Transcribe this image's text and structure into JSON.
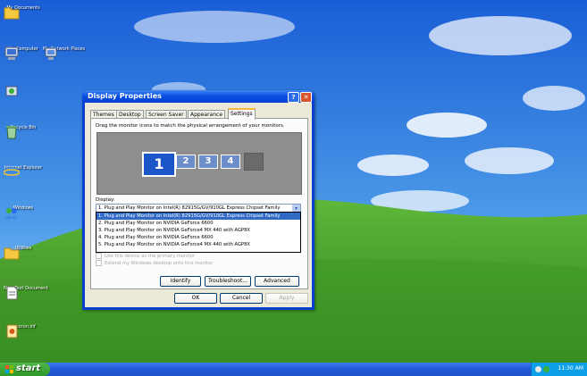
{
  "desktop": {
    "icons": [
      {
        "label": "My Documents",
        "icon": "folder-icon"
      },
      {
        "label": "My Computer",
        "icon": "computer-icon"
      },
      {
        "label": "My Network Places",
        "icon": "network-icon"
      },
      {
        "label": "Recycle Bin",
        "icon": "recycle-bin-icon"
      },
      {
        "label": "Internet Explorer",
        "icon": "internet-explorer-icon"
      },
      {
        "label": "Windows",
        "icon": "msn-icon"
      },
      {
        "label": "Utilities",
        "icon": "folder-icon"
      },
      {
        "label": "New Text Document",
        "icon": "text-document-icon"
      },
      {
        "label": "autorun.inf",
        "icon": "settings-file-icon"
      }
    ]
  },
  "window": {
    "title": "Display Properties",
    "tabs": [
      "Themes",
      "Desktop",
      "Screen Saver",
      "Appearance",
      "Settings"
    ],
    "active_tab": "Settings",
    "instruction": "Drag the monitor icons to match the physical arrangement of your monitors.",
    "monitors": [
      "1",
      "2",
      "3",
      "4",
      ""
    ],
    "display_label": "Display:",
    "display_value": "1. Plug and Play Monitor on Intel(R) 82915G/GV/910GL Express Chipset Family",
    "display_options": [
      "1. Plug and Play Monitor on Intel(R) 82915G/GV/910GL Express Chipset Family",
      "2. Plug and Play Monitor on NVIDIA GeForce 6600",
      "3. Plug and Play Monitor on NVIDIA GeForce4 MX 440 with AGP8X",
      "4. Plug and Play Monitor on NVIDIA GeForce 6600",
      "5. Plug and Play Monitor on NVIDIA GeForce4 MX 440 with AGP8X"
    ],
    "checkbox_primary": "Use this device as the primary monitor",
    "checkbox_extend": "Extend my Windows desktop onto this monitor",
    "buttons": {
      "identify": "Identify",
      "troubleshoot": "Troubleshoot...",
      "advanced": "Advanced",
      "ok": "OK",
      "cancel": "Cancel",
      "apply": "Apply"
    },
    "help_glyph": "?",
    "close_glyph": "✕"
  },
  "taskbar": {
    "start_label": "start",
    "clock": "11:30 AM"
  },
  "colors": {
    "titlebar": "#0a4fe0",
    "taskbar": "#245edb",
    "start_button": "#2f9a2a",
    "selection": "#316ac5"
  }
}
